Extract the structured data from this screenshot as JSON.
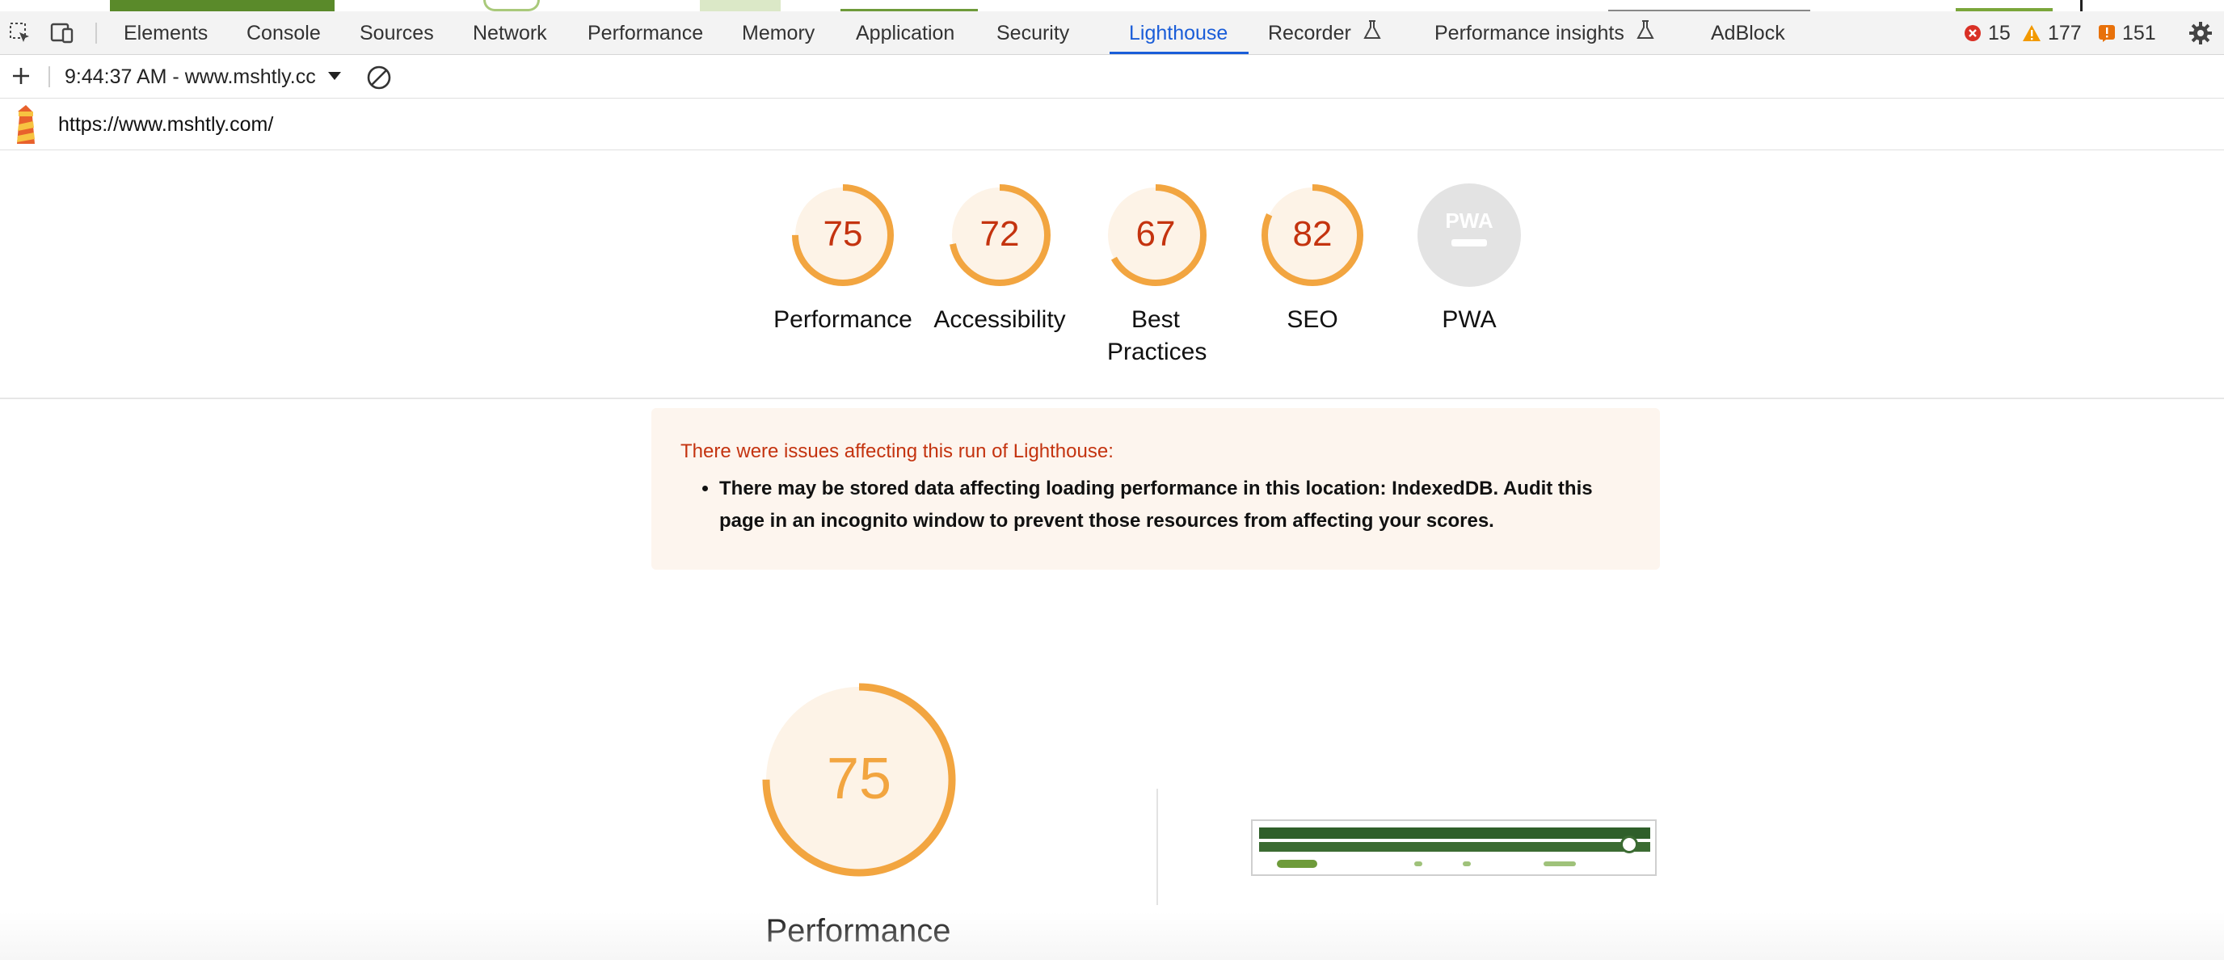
{
  "devtools": {
    "tabs": [
      {
        "label": "Elements"
      },
      {
        "label": "Console"
      },
      {
        "label": "Sources"
      },
      {
        "label": "Network"
      },
      {
        "label": "Performance"
      },
      {
        "label": "Memory"
      },
      {
        "label": "Application"
      },
      {
        "label": "Security"
      },
      {
        "label": "Lighthouse",
        "active": true
      },
      {
        "label": "Recorder",
        "icon": "flask-icon"
      },
      {
        "label": "Performance insights",
        "icon": "flask-icon"
      },
      {
        "label": "AdBlock"
      }
    ],
    "counters": {
      "errors": "15",
      "warnings": "177",
      "issues": "151"
    },
    "colors": {
      "accent": "#1a5dd8",
      "error": "#d93025",
      "warning": "#f29900"
    }
  },
  "toolbar": {
    "run_label": "9:44:37 AM - www.mshtly.cc"
  },
  "report": {
    "url": "https://www.mshtly.com/",
    "categories": [
      {
        "name": "Performance",
        "score": "75"
      },
      {
        "name": "Accessibility",
        "score": "72"
      },
      {
        "name": "Best Practices",
        "score": "67"
      },
      {
        "name": "SEO",
        "score": "82"
      },
      {
        "name": "PWA",
        "score": ""
      }
    ],
    "pwa_badge": "PWA",
    "warning": {
      "title": "There were issues affecting this run of Lighthouse:",
      "items": [
        "There may be stored data affecting loading performance in this location: IndexedDB. Audit this page in an incognito window to prevent those resources from affecting your scores."
      ]
    },
    "main_gauge": {
      "name": "Performance",
      "score": "75"
    },
    "colors": {
      "average": "#f2a540",
      "average_text": "#c4330f",
      "average_bg": "#fdf3e7"
    }
  }
}
